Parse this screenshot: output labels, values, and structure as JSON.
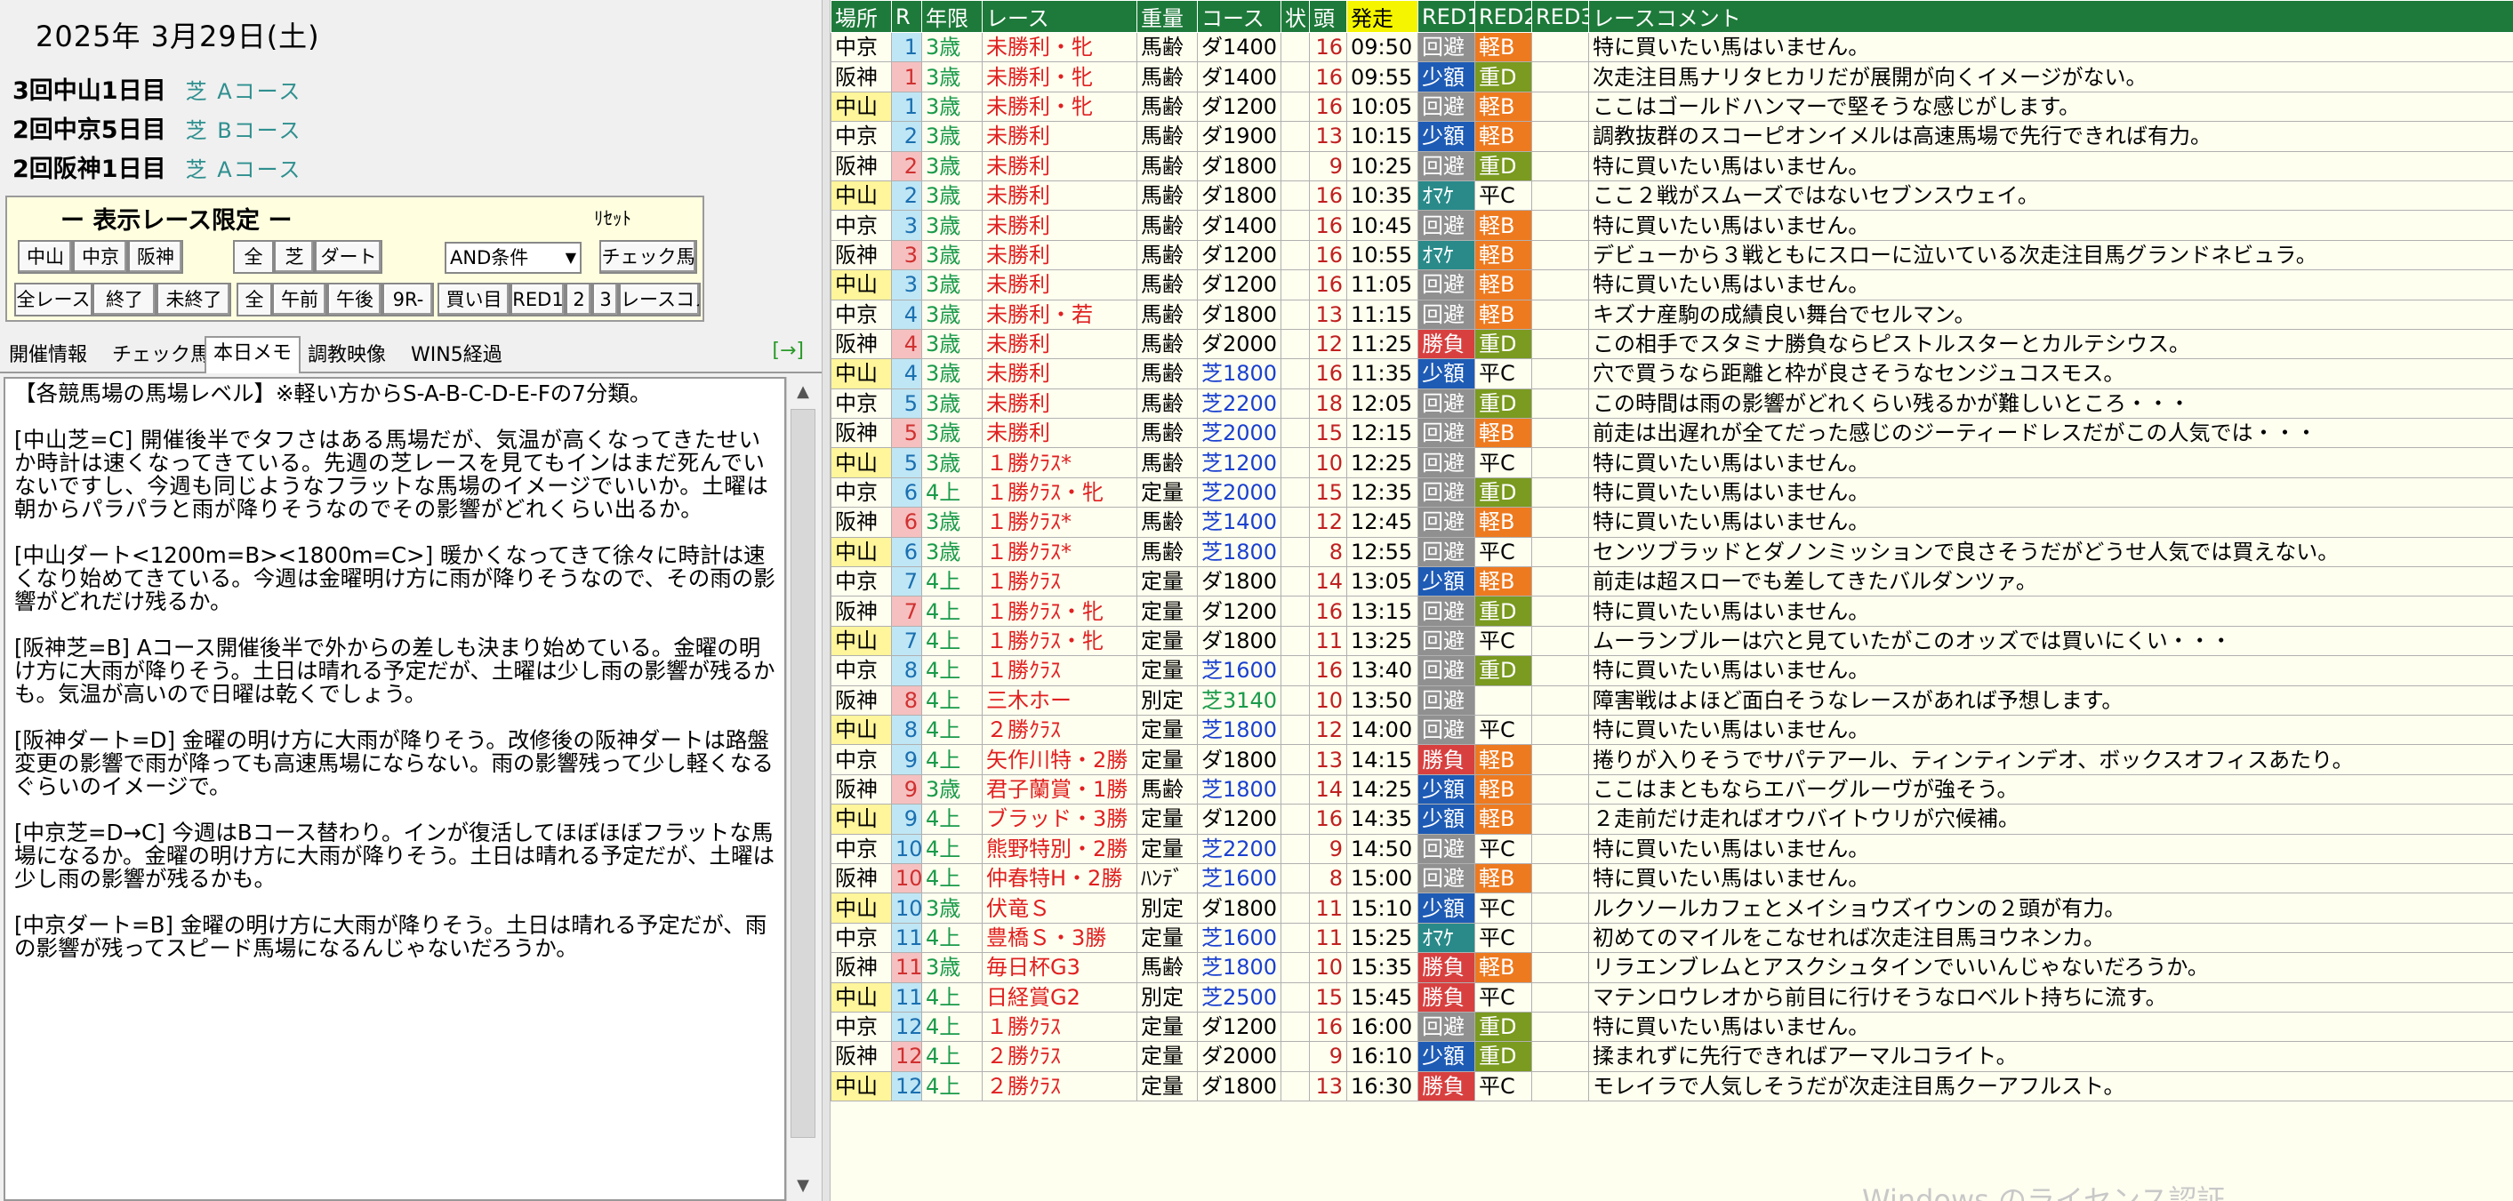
{
  "date": "2025年 3月29日(土)",
  "courses": [
    {
      "name": "3回中山1日目",
      "type": "芝 Aコース"
    },
    {
      "name": "2回中京5日目",
      "type": "芝 Bコース"
    },
    {
      "name": "2回阪神1日目",
      "type": "芝 Aコース"
    }
  ],
  "filter": {
    "title": "ー 表示レース限定 ー",
    "reset": "ﾘｾｯﾄ",
    "venues": [
      "中山",
      "中京",
      "阪神"
    ],
    "surfaces": [
      "全",
      "芝",
      "ダート"
    ],
    "condition": "AND条件",
    "check_horse": "チェック馬",
    "status": [
      "全レース",
      "終了",
      "未終了"
    ],
    "time": [
      "全",
      "午前",
      "午後",
      "9R-"
    ],
    "kaime": "買い目",
    "marks": [
      "RED1",
      "2",
      "3"
    ],
    "race_comment": "レースコメ"
  },
  "tabs": [
    "開催情報",
    "チェック馬",
    "本日メモ",
    "調教映像",
    "WIN5経過"
  ],
  "tab_arrow": "[→]",
  "memo": [
    "【各競馬場の馬場レベル】※軽い方からS-A-B-C-D-E-Fの7分類。",
    "[中山芝=C] 開催後半でタフさはある馬場だが、気温が高くなってきたせいか時計は速くなってきている。先週の芝レースを見てもインはまだ死んでいないですし、今週も同じようなフラットな馬場のイメージでいいか。土曜は朝からパラパラと雨が降りそうなのでその影響がどれくらい出るか。",
    "[中山ダート<1200m=B><1800m=C>] 暖かくなってきて徐々に時計は速くなり始めてきている。今週は金曜明け方に雨が降りそうなので、その雨の影響がどれだけ残るか。",
    "",
    "[阪神芝=B] Aコース開催後半で外からの差しも決まり始めている。金曜の明け方に大雨が降りそう。土日は晴れる予定だが、土曜は少し雨の影響が残るかも。気温が高いので日曜は乾くでしょう。",
    "",
    "[阪神ダート=D] 金曜の明け方に大雨が降りそう。改修後の阪神ダートは路盤変更の影響で雨が降っても高速馬場にならない。雨の影響残って少し軽くなるぐらいのイメージで。",
    "",
    "",
    "[中京芝=D→C] 今週はBコース替わり。インが復活してほぼほぼフラットな馬場になるか。金曜の明け方に大雨が降りそう。土日は晴れる予定だが、土曜は少し雨の影響が残るかも。",
    "[中京ダート=B] 金曜の明け方に大雨が降りそう。土日は晴れる予定だが、雨の影響が残ってスピード馬場になるんじゃないだろうか。"
  ],
  "table": {
    "headers": [
      "場所",
      "R",
      "年限",
      "レース",
      "重量",
      "コース",
      "状",
      "頭",
      "発走",
      "RED1",
      "RED2",
      "RED3",
      "レースコメント"
    ],
    "rows": [
      [
        "中京",
        "1",
        "3歳",
        "未勝利・牝",
        "馬齢",
        "ダ1400",
        "",
        "16",
        "09:50",
        "回避",
        "軽B",
        "",
        "特に買いたい馬はいません。"
      ],
      [
        "阪神",
        "1",
        "3歳",
        "未勝利・牝",
        "馬齢",
        "ダ1400",
        "",
        "16",
        "09:55",
        "少額",
        "重D",
        "",
        "次走注目馬ナリタヒカリだが展開が向くイメージがない。"
      ],
      [
        "中山",
        "1",
        "3歳",
        "未勝利・牝",
        "馬齢",
        "ダ1200",
        "",
        "16",
        "10:05",
        "回避",
        "軽B",
        "",
        "ここはゴールドハンマーで堅そうな感じがします。"
      ],
      [
        "中京",
        "2",
        "3歳",
        "未勝利",
        "馬齢",
        "ダ1900",
        "",
        "13",
        "10:15",
        "少額",
        "軽B",
        "",
        "調教抜群のスコーピオンイメルは高速馬場で先行できれば有力。"
      ],
      [
        "阪神",
        "2",
        "3歳",
        "未勝利",
        "馬齢",
        "ダ1800",
        "",
        "9",
        "10:25",
        "回避",
        "重D",
        "",
        "特に買いたい馬はいません。"
      ],
      [
        "中山",
        "2",
        "3歳",
        "未勝利",
        "馬齢",
        "ダ1800",
        "",
        "16",
        "10:35",
        "ｵﾏｹ",
        "平C",
        "",
        "ここ２戦がスムーズではないセブンスウェイ。"
      ],
      [
        "中京",
        "3",
        "3歳",
        "未勝利",
        "馬齢",
        "ダ1400",
        "",
        "16",
        "10:45",
        "回避",
        "軽B",
        "",
        "特に買いたい馬はいません。"
      ],
      [
        "阪神",
        "3",
        "3歳",
        "未勝利",
        "馬齢",
        "ダ1200",
        "",
        "16",
        "10:55",
        "ｵﾏｹ",
        "軽B",
        "",
        "デビューから３戦ともにスローに泣いている次走注目馬グランドネビュラ。"
      ],
      [
        "中山",
        "3",
        "3歳",
        "未勝利",
        "馬齢",
        "ダ1200",
        "",
        "16",
        "11:05",
        "回避",
        "軽B",
        "",
        "特に買いたい馬はいません。"
      ],
      [
        "中京",
        "4",
        "3歳",
        "未勝利・若",
        "馬齢",
        "ダ1800",
        "",
        "13",
        "11:15",
        "回避",
        "軽B",
        "",
        "キズナ産駒の成績良い舞台でセルマン。"
      ],
      [
        "阪神",
        "4",
        "3歳",
        "未勝利",
        "馬齢",
        "ダ2000",
        "",
        "12",
        "11:25",
        "勝負",
        "重D",
        "",
        "この相手でスタミナ勝負ならピストルスターとカルテシウス。"
      ],
      [
        "中山",
        "4",
        "3歳",
        "未勝利",
        "馬齢",
        "芝1800",
        "",
        "16",
        "11:35",
        "少額",
        "平C",
        "",
        "穴で買うなら距離と枠が良さそうなセンジュコスモス。"
      ],
      [
        "中京",
        "5",
        "3歳",
        "未勝利",
        "馬齢",
        "芝2200",
        "",
        "18",
        "12:05",
        "回避",
        "重D",
        "",
        "この時間は雨の影響がどれくらい残るかが難しいところ・・・"
      ],
      [
        "阪神",
        "5",
        "3歳",
        "未勝利",
        "馬齢",
        "芝2000",
        "",
        "15",
        "12:15",
        "回避",
        "軽B",
        "",
        "前走は出遅れが全てだった感じのジーティードレスだがこの人気では・・・"
      ],
      [
        "中山",
        "5",
        "3歳",
        "１勝ｸﾗｽ*",
        "馬齢",
        "芝1200",
        "",
        "10",
        "12:25",
        "回避",
        "平C",
        "",
        "特に買いたい馬はいません。"
      ],
      [
        "中京",
        "6",
        "4上",
        "１勝ｸﾗｽ・牝",
        "定量",
        "芝2000",
        "",
        "15",
        "12:35",
        "回避",
        "重D",
        "",
        "特に買いたい馬はいません。"
      ],
      [
        "阪神",
        "6",
        "3歳",
        "１勝ｸﾗｽ*",
        "馬齢",
        "芝1400",
        "",
        "12",
        "12:45",
        "回避",
        "軽B",
        "",
        "特に買いたい馬はいません。"
      ],
      [
        "中山",
        "6",
        "3歳",
        "１勝ｸﾗｽ*",
        "馬齢",
        "芝1800",
        "",
        "8",
        "12:55",
        "回避",
        "平C",
        "",
        "センツブラッドとダノンミッションで良さそうだがどうせ人気では買えない。"
      ],
      [
        "中京",
        "7",
        "4上",
        "１勝ｸﾗｽ",
        "定量",
        "ダ1800",
        "",
        "14",
        "13:05",
        "少額",
        "軽B",
        "",
        "前走は超スローでも差してきたバルダンツァ。"
      ],
      [
        "阪神",
        "7",
        "4上",
        "１勝ｸﾗｽ・牝",
        "定量",
        "ダ1200",
        "",
        "16",
        "13:15",
        "回避",
        "重D",
        "",
        "特に買いたい馬はいません。"
      ],
      [
        "中山",
        "7",
        "4上",
        "１勝ｸﾗｽ・牝",
        "定量",
        "ダ1800",
        "",
        "11",
        "13:25",
        "回避",
        "平C",
        "",
        "ムーランブルーは穴と見ていたがこのオッズでは買いにくい・・・"
      ],
      [
        "中京",
        "8",
        "4上",
        "１勝ｸﾗｽ",
        "定量",
        "芝1600",
        "",
        "16",
        "13:40",
        "回避",
        "重D",
        "",
        "特に買いたい馬はいません。"
      ],
      [
        "阪神",
        "8",
        "4上",
        "三木ホー",
        "別定",
        "芝3140",
        "",
        "10",
        "13:50",
        "回避",
        "",
        "",
        "障害戦はよほど面白そうなレースがあれば予想します。"
      ],
      [
        "中山",
        "8",
        "4上",
        "２勝ｸﾗｽ",
        "定量",
        "芝1800",
        "",
        "12",
        "14:00",
        "回避",
        "平C",
        "",
        "特に買いたい馬はいません。"
      ],
      [
        "中京",
        "9",
        "4上",
        "矢作川特・2勝",
        "定量",
        "ダ1800",
        "",
        "13",
        "14:15",
        "勝負",
        "軽B",
        "",
        "捲りが入りそうでサパテアール、ティンティンデオ、ボックスオフィスあたり。"
      ],
      [
        "阪神",
        "9",
        "3歳",
        "君子蘭賞・1勝",
        "馬齢",
        "芝1800",
        "",
        "14",
        "14:25",
        "少額",
        "軽B",
        "",
        "ここはまともならエバーグルーヴが強そう。"
      ],
      [
        "中山",
        "9",
        "4上",
        "ブラッド・3勝",
        "定量",
        "ダ1200",
        "",
        "16",
        "14:35",
        "少額",
        "軽B",
        "",
        "２走前だけ走ればオウバイトウリが穴候補。"
      ],
      [
        "中京",
        "10",
        "4上",
        "熊野特別・2勝",
        "定量",
        "芝2200",
        "",
        "9",
        "14:50",
        "回避",
        "平C",
        "",
        "特に買いたい馬はいません。"
      ],
      [
        "阪神",
        "10",
        "4上",
        "仲春特H・2勝",
        "ﾊﾝﾃﾞ",
        "芝1600",
        "",
        "8",
        "15:00",
        "回避",
        "軽B",
        "",
        "特に買いたい馬はいません。"
      ],
      [
        "中山",
        "10",
        "3歳",
        "伏竜Ｓ",
        "別定",
        "ダ1800",
        "",
        "11",
        "15:10",
        "少額",
        "平C",
        "",
        "ルクソールカフェとメイショウズイウンの２頭が有力。"
      ],
      [
        "中京",
        "11",
        "4上",
        "豊橋Ｓ・3勝",
        "定量",
        "芝1600",
        "",
        "11",
        "15:25",
        "ｵﾏｹ",
        "平C",
        "",
        "初めてのマイルをこなせれば次走注目馬ヨウネンカ。"
      ],
      [
        "阪神",
        "11",
        "3歳",
        "毎日杯G3",
        "馬齢",
        "芝1800",
        "",
        "10",
        "15:35",
        "勝負",
        "軽B",
        "",
        "リラエンブレムとアスクシュタインでいいんじゃないだろうか。"
      ],
      [
        "中山",
        "11",
        "4上",
        "日経賞G2",
        "別定",
        "芝2500",
        "",
        "15",
        "15:45",
        "勝負",
        "平C",
        "",
        "マテンロウレオから前目に行けそうなロベルト持ちに流す。"
      ],
      [
        "中京",
        "12",
        "4上",
        "１勝ｸﾗｽ",
        "定量",
        "ダ1200",
        "",
        "16",
        "16:00",
        "回避",
        "重D",
        "",
        "特に買いたい馬はいません。"
      ],
      [
        "阪神",
        "12",
        "4上",
        "２勝ｸﾗｽ",
        "定量",
        "ダ2000",
        "",
        "9",
        "16:10",
        "少額",
        "重D",
        "",
        "揉まれずに先行できればアーマルコライト。"
      ],
      [
        "中山",
        "12",
        "4上",
        "２勝ｸﾗｽ",
        "定量",
        "ダ1800",
        "",
        "13",
        "16:30",
        "勝負",
        "平C",
        "",
        "モレイラで人気しそうだが次走注目馬クーアフルスト。"
      ]
    ]
  },
  "watermark": "Windows のライセンス認証"
}
